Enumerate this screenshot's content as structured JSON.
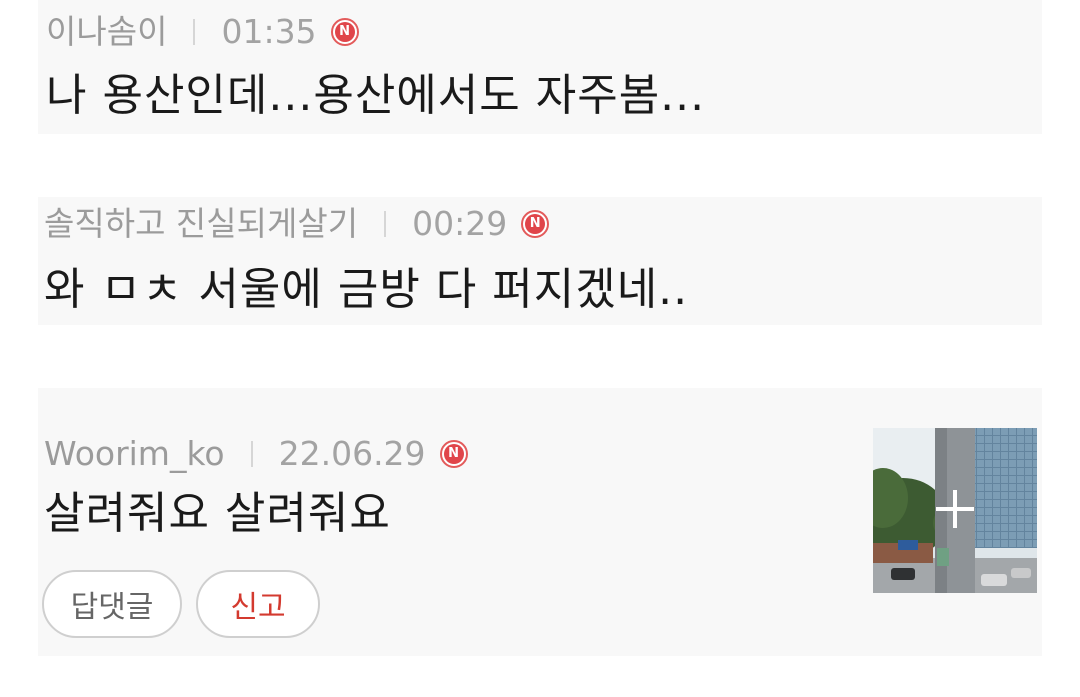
{
  "comments": [
    {
      "author": "이나솜이",
      "time": "01:35",
      "badge": "N",
      "text": "나 용산인데...용산에서도 자주봄..."
    },
    {
      "author": "솔직하고 진실되게살기",
      "time": "00:29",
      "badge": "N",
      "text": "와 ㅁㅊ 서울에 금방 다 퍼지겠네.."
    },
    {
      "author": "Woorim_ko",
      "time": "22.06.29",
      "badge": "N",
      "text": "살려줘요 살려줘요",
      "actions": {
        "reply": "답댓글",
        "report": "신고"
      }
    }
  ],
  "colors": {
    "badge_red": "#e0454a",
    "report_red": "#d33a2f",
    "card_bg": "#f8f8f8"
  }
}
